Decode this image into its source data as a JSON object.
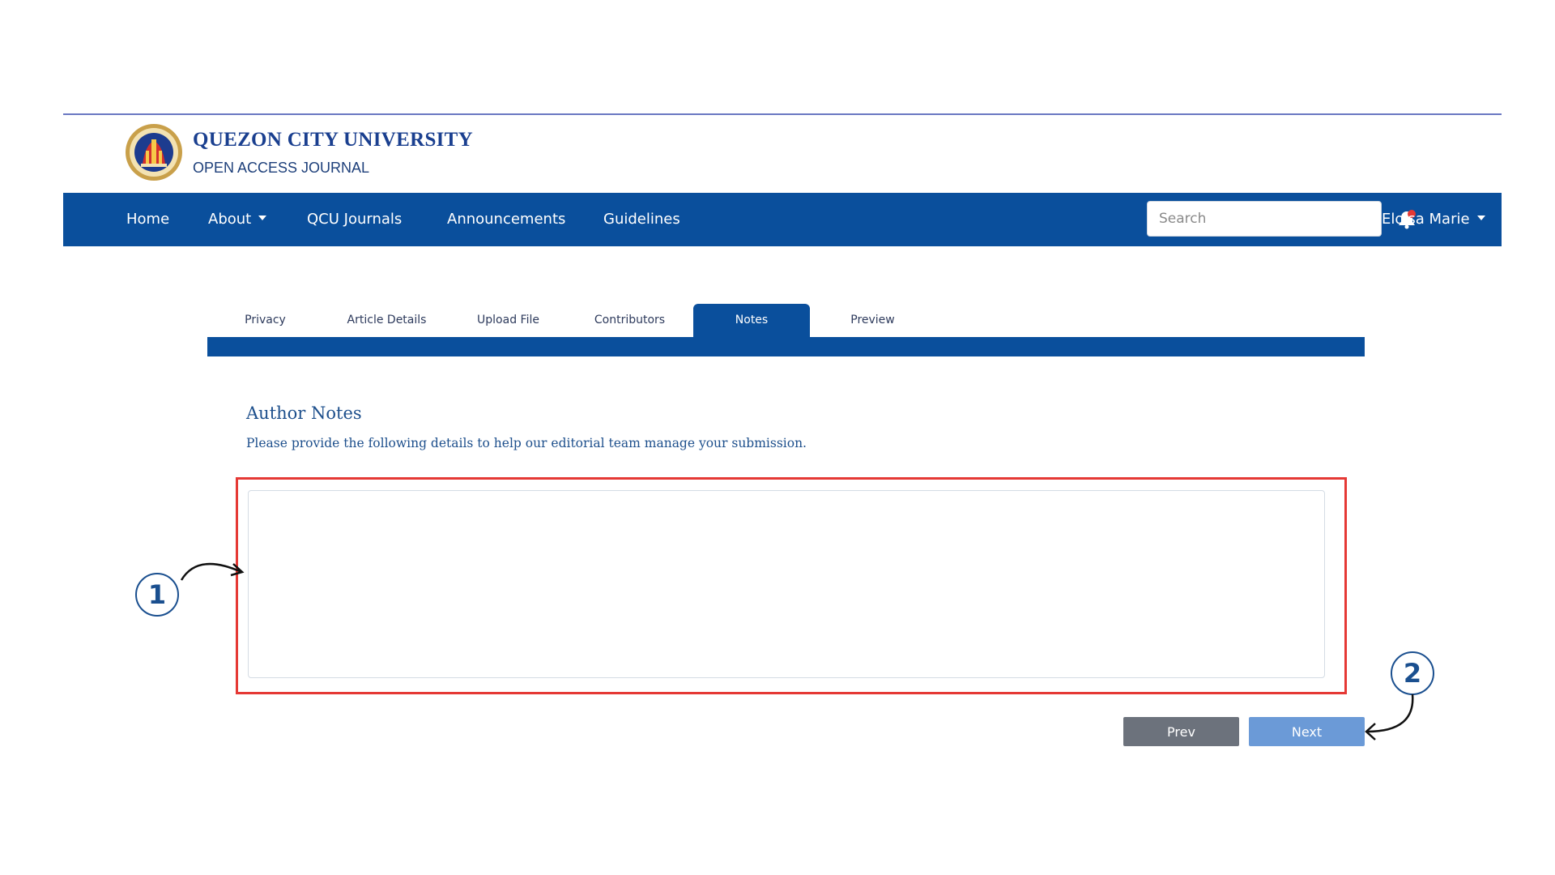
{
  "brand": {
    "title": "QUEZON CITY UNIVERSITY",
    "subtitle": "OPEN ACCESS JOURNAL",
    "logo_icon": "university-seal-logo"
  },
  "nav": {
    "items": [
      {
        "label": "Home"
      },
      {
        "label": "About",
        "has_dropdown": true
      },
      {
        "label": "QCU Journals"
      },
      {
        "label": "Announcements"
      },
      {
        "label": "Guidelines"
      }
    ],
    "search_placeholder": "Search",
    "bell_icon": "bell-icon",
    "user_name": "Eloisa Marie",
    "bar_color": "#0a4f9c"
  },
  "tabs": [
    {
      "label": "Privacy",
      "active": false
    },
    {
      "label": "Article Details",
      "active": false
    },
    {
      "label": "Upload File",
      "active": false
    },
    {
      "label": "Contributors",
      "active": false
    },
    {
      "label": "Notes",
      "active": true
    },
    {
      "label": "Preview",
      "active": false
    }
  ],
  "notes": {
    "title": "Author Notes",
    "description": "Please provide the following details to help our editorial team manage your submission.",
    "value": "",
    "highlight_color": "#e53935"
  },
  "buttons": {
    "prev_label": "Prev",
    "next_label": "Next"
  },
  "callouts": {
    "first": "1",
    "second": "2"
  }
}
